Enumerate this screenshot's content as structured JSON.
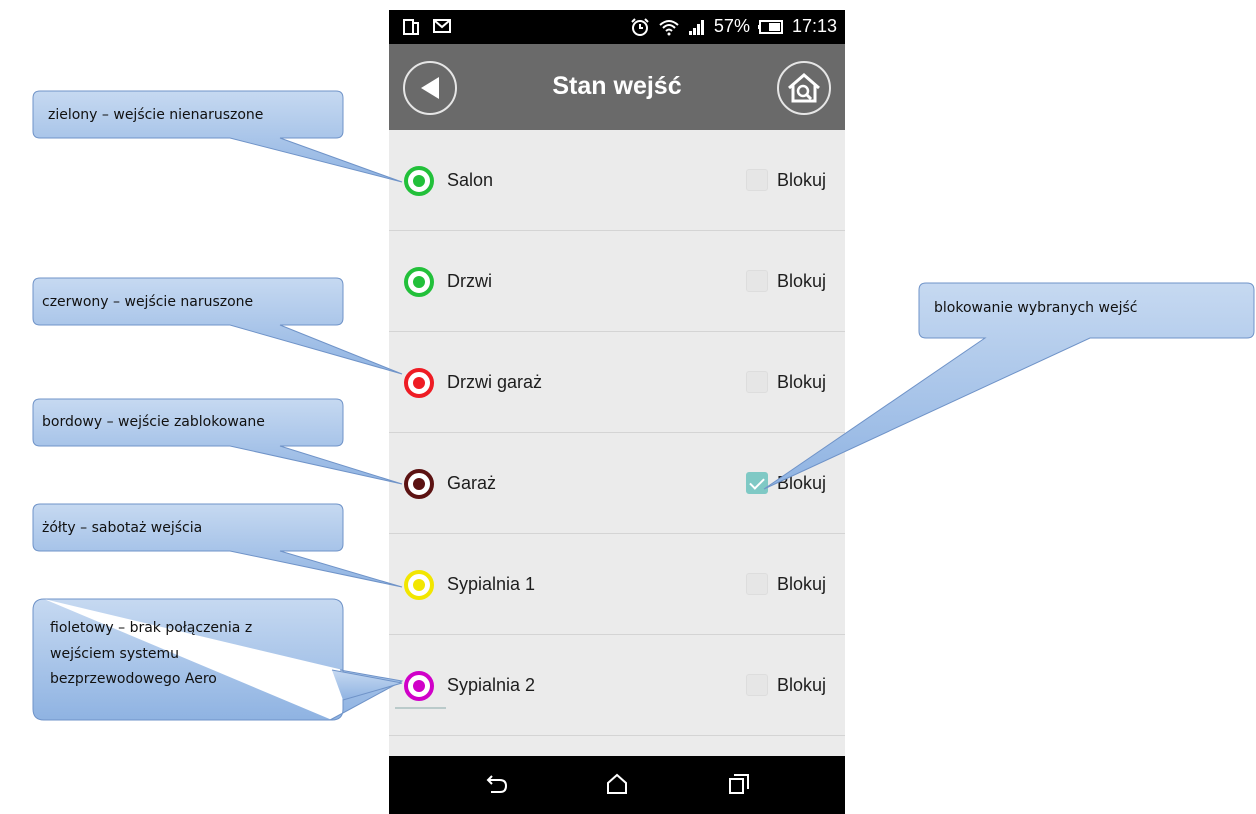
{
  "status_bar": {
    "battery": "57%",
    "time": "17:13"
  },
  "app_bar": {
    "title": "Stan wejść"
  },
  "rows": [
    {
      "label": "Salon",
      "status_color": "#22c03a",
      "block_label": "Blokuj",
      "blocked": false
    },
    {
      "label": "Drzwi",
      "status_color": "#22c03a",
      "block_label": "Blokuj",
      "blocked": false
    },
    {
      "label": "Drzwi garaż",
      "status_color": "#ee1c24",
      "block_label": "Blokuj",
      "blocked": false
    },
    {
      "label": "Garaż",
      "status_color": "#5c1212",
      "block_label": "Blokuj",
      "blocked": true
    },
    {
      "label": "Sypialnia 1",
      "status_color": "#f2e600",
      "block_label": "Blokuj",
      "blocked": false
    },
    {
      "label": "Sypialnia 2",
      "status_color": "#d000c8",
      "block_label": "Blokuj",
      "blocked": false
    }
  ],
  "callouts": {
    "green": "zielony – wejście nienaruszone",
    "red": "czerwony – wejście naruszone",
    "maroon": "bordowy – wejście zablokowane",
    "yellow": "żółty – sabotaż wejścia",
    "purple_line1": "fioletowy – brak połączenia z",
    "purple_line2": "wejściem systemu",
    "purple_line3": "bezprzewodowego Aero",
    "block": "blokowanie wybranych wejść"
  },
  "icons": {
    "back": "back-arrow-icon",
    "home": "home-search-icon",
    "nav_back": "nav-back-icon",
    "nav_home": "nav-home-icon",
    "nav_recent": "nav-recent-apps-icon"
  }
}
